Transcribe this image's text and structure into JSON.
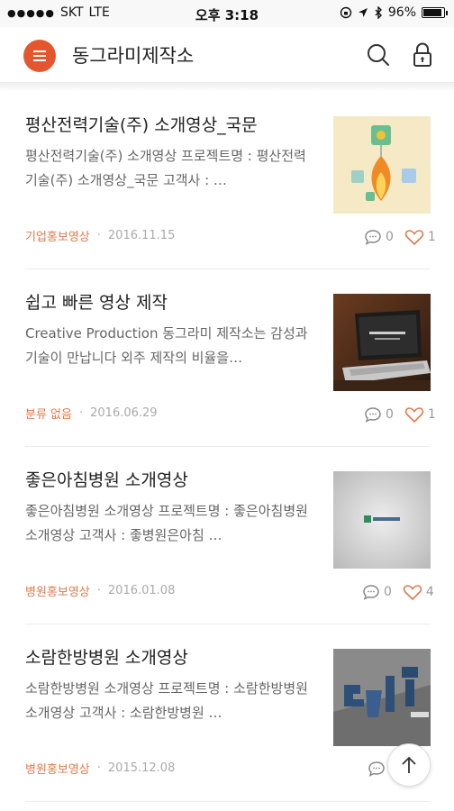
{
  "status_bar": {
    "signal": "●●●●●",
    "carrier": "SKT",
    "network": "LTE",
    "time": "오후 3:18",
    "battery_text": "96%",
    "battery_level": 0.96
  },
  "header": {
    "title": "동그라미제작소",
    "icons": [
      "menu-icon",
      "search-icon",
      "lock-icon"
    ],
    "accent_color": "#e4572e"
  },
  "posts": [
    {
      "title": "평산전력기술(주) 소개영상_국문",
      "excerpt": "평산전력기술(주) 소개영상 프로젝트명 : 평산전력기술(주) 소개영상_국문 고객사 : …",
      "category": "기업홍보영상",
      "date": "2016.11.15",
      "comments": "0",
      "likes": "1"
    },
    {
      "title": "쉽고 빠른 영상 제작",
      "excerpt": "Creative Production 동그라미 제작소는 감성과 기술이 만납니다 외주 제작의 비율을…",
      "category": "분류 없음",
      "date": "2016.06.29",
      "comments": "0",
      "likes": "1"
    },
    {
      "title": "좋은아침병원 소개영상",
      "excerpt": "좋은아침병원 소개영상 프로젝트명 : 좋은아침병원 소개영상 고객사 : 좋병원은아침 …",
      "category": "병원홍보영상",
      "date": "2016.01.08",
      "comments": "0",
      "likes": "4"
    },
    {
      "title": "소람한방병원 소개영상",
      "excerpt": "소람한방병원 소개영상 프로젝트명 : 소람한방병원 소개영상 고객사 : 소람한방병원 …",
      "category": "병원홍보영상",
      "date": "2015.12.08",
      "comments": "",
      "likes": ""
    }
  ]
}
